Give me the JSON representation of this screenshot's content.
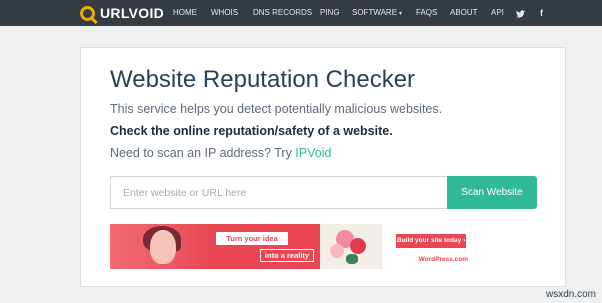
{
  "brand": {
    "logo_text": "URLVOID",
    "logo_icon": "magnifier-icon",
    "accent": "#f2a900"
  },
  "nav": {
    "items": [
      "HOME",
      "WHOIS",
      "DNS RECORDS",
      "PING",
      "SOFTWARE",
      "FAQS",
      "ABOUT",
      "API"
    ],
    "software_caret": "▾",
    "social": [
      {
        "name": "twitter-icon",
        "glyph": "🐦"
      },
      {
        "name": "facebook-icon",
        "glyph": "f"
      }
    ]
  },
  "main": {
    "title": "Website Reputation Checker",
    "description": "This service helps you detect potentially malicious websites.",
    "strong_line": "Check the online reputation/safety of a website.",
    "ask_prefix": "Need to scan an IP address? Try ",
    "ask_link": "IPVoid"
  },
  "search": {
    "placeholder": "Enter website or URL here",
    "value": "",
    "button_label": "Scan Website",
    "button_color": "#30b995"
  },
  "ad": {
    "chip1": "Turn your idea",
    "chip2": "into a reality",
    "cta": "Build your site today ›",
    "brand": "WordPress.com",
    "color": "#e94753"
  },
  "watermark": "wsxdn.com"
}
